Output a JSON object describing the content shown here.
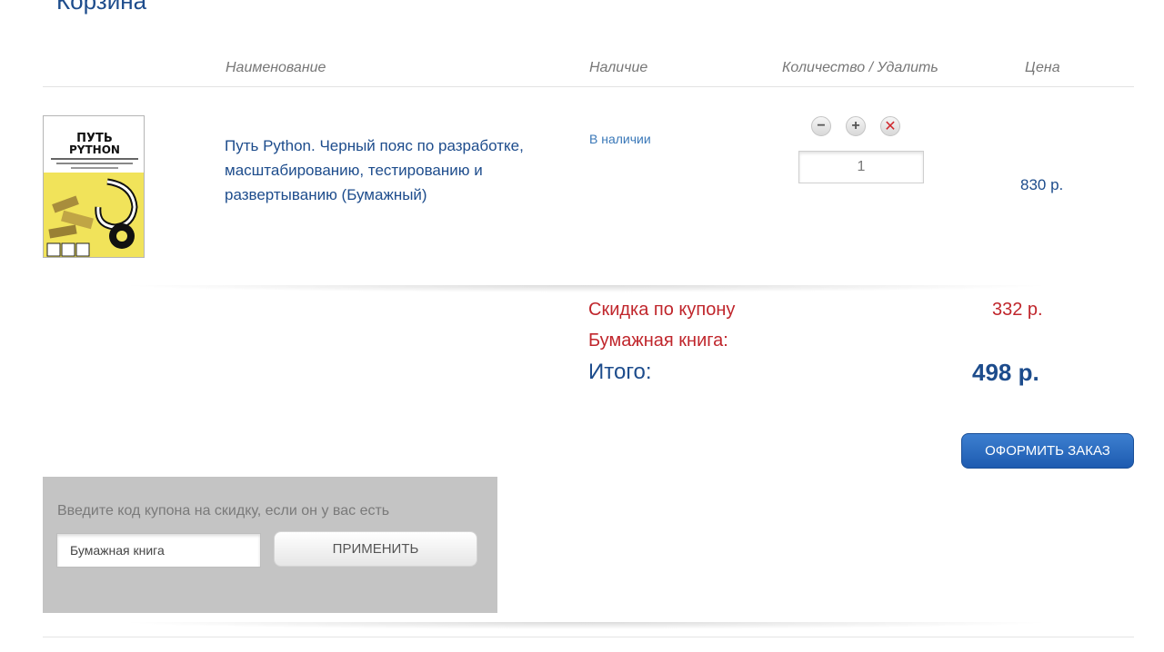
{
  "page": {
    "title": "Корзина"
  },
  "table": {
    "headers": {
      "name": "Наименование",
      "availability": "Наличие",
      "quantity_remove": "Количество / Удалить",
      "price": "Цена"
    }
  },
  "cart": {
    "items": [
      {
        "title": "Путь Python. Черный пояс по разработке, масштабированию, тестированию и развертыванию (Бумажный)",
        "availability": "В наличии",
        "quantity": "1",
        "price": "830 р.",
        "cover": {
          "title_line1": "ПУТЬ",
          "title_line2": "PYTHON",
          "bg_color": "#f1e35a"
        },
        "controls": {
          "decrease_symbol": "−",
          "increase_symbol": "+",
          "remove_symbol": "✕"
        }
      }
    ]
  },
  "summary": {
    "discount_label": "Скидка по купону",
    "discount_value": "332 р.",
    "coupon_name": "Бумажная книга:",
    "total_label": "Итого:",
    "total_value": "498 р."
  },
  "order": {
    "button_label": "ОФОРМИТЬ ЗАКАЗ"
  },
  "coupon": {
    "hint": "Введите код купона на скидку, если он у вас есть",
    "input_value": "Бумажная книга",
    "apply_label": "ПРИМЕНИТЬ"
  },
  "colors": {
    "primary": "#1d4c8c",
    "discount": "#c0262c",
    "order_button": "#2a6cc2",
    "coupon_panel": "#c4c4c4"
  }
}
